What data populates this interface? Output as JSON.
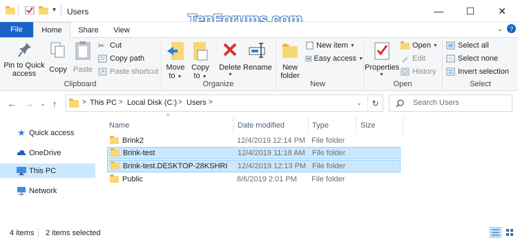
{
  "window": {
    "title": "Users",
    "watermark": "TenForums.com",
    "minimize": "—",
    "maximize": "☐",
    "close": "✕"
  },
  "tabs": {
    "file": "File",
    "home": "Home",
    "share": "Share",
    "view": "View"
  },
  "ribbon": {
    "clipboard": {
      "label": "Clipboard",
      "pin_line1": "Pin to Quick",
      "pin_line2": "access",
      "copy": "Copy",
      "paste": "Paste",
      "cut": "Cut",
      "copy_path": "Copy path",
      "paste_shortcut": "Paste shortcut"
    },
    "organize": {
      "label": "Organize",
      "move_to_line1": "Move",
      "move_to_line2": "to",
      "copy_to_line1": "Copy",
      "copy_to_line2": "to",
      "delete": "Delete",
      "rename": "Rename"
    },
    "new": {
      "label": "New",
      "new_folder_line1": "New",
      "new_folder_line2": "folder",
      "new_item": "New item",
      "easy_access": "Easy access"
    },
    "open": {
      "label": "Open",
      "properties": "Properties",
      "open": "Open",
      "edit": "Edit",
      "history": "History"
    },
    "select": {
      "label": "Select",
      "select_all": "Select all",
      "select_none": "Select none",
      "invert_selection": "Invert selection"
    }
  },
  "address": {
    "crumbs": [
      "This PC",
      "Local Disk (C:)",
      "Users"
    ],
    "separator": ">",
    "search_placeholder": "Search Users"
  },
  "nav_pane": {
    "items": [
      {
        "label": "Quick access",
        "icon": "star-icon"
      },
      {
        "label": "OneDrive",
        "icon": "cloud-icon"
      },
      {
        "label": "This PC",
        "icon": "computer-icon",
        "selected": true
      },
      {
        "label": "Network",
        "icon": "network-icon"
      }
    ]
  },
  "file_list": {
    "columns": [
      "Name",
      "Date modified",
      "Type",
      "Size"
    ],
    "sort_indicator": "^",
    "rows": [
      {
        "name": "Brink2",
        "date": "12/4/2019 12:14 PM",
        "type": "File folder",
        "selected": false
      },
      {
        "name": "Brink-test",
        "date": "12/4/2019 11:18 AM",
        "type": "File folder",
        "selected": true
      },
      {
        "name": "Brink-test.DESKTOP-28KSHRI",
        "date": "12/4/2019 12:13 PM",
        "type": "File folder",
        "selected": true
      },
      {
        "name": "Public",
        "date": "8/6/2019 2:01 PM",
        "type": "File folder",
        "selected": false
      }
    ]
  },
  "status_bar": {
    "item_count": "4 items",
    "selected_count": "2 items selected"
  },
  "colors": {
    "accent": "#1a63c6",
    "selection": "#cce8ff",
    "selection_border": "#99d1ff",
    "folder": "#f8d775"
  }
}
